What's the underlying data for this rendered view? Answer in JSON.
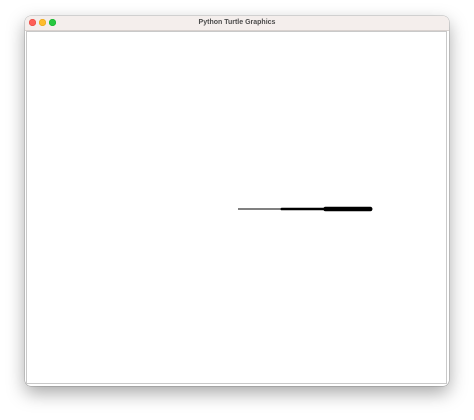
{
  "window": {
    "title": "Python Turtle Graphics"
  },
  "titlebar_buttons": [
    {
      "name": "close",
      "color": "#fe5f57"
    },
    {
      "name": "minimize",
      "color": "#febc2e"
    },
    {
      "name": "zoom",
      "color": "#28c840"
    }
  ],
  "turtle_canvas": {
    "background": "#ffffff",
    "pen_color": "#000000",
    "strokes": [
      {
        "width": 1
      },
      {
        "width": 3
      },
      {
        "width": 5
      }
    ]
  }
}
